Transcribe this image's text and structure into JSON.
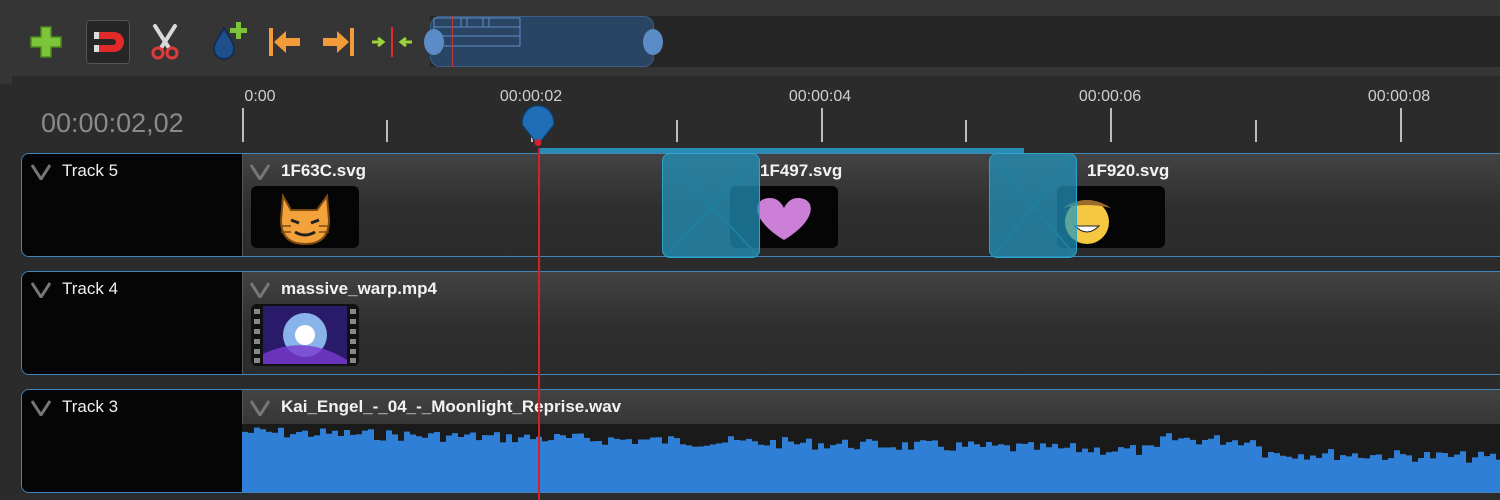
{
  "toolbar": {
    "buttons": [
      {
        "name": "add-track",
        "icon": "plus-icon"
      },
      {
        "name": "snapping",
        "icon": "magnet-icon",
        "active": true
      },
      {
        "name": "razor",
        "icon": "scissors-icon"
      },
      {
        "name": "add-marker",
        "icon": "drop-plus-icon"
      },
      {
        "name": "previous-marker",
        "icon": "arrow-left-bar-icon"
      },
      {
        "name": "next-marker",
        "icon": "arrow-right-bar-icon"
      },
      {
        "name": "center-playhead",
        "icon": "center-arrows-icon"
      }
    ]
  },
  "timeline": {
    "current_time": "00:00:02,02",
    "ruler_labels": [
      "0:00",
      "00:00:02",
      "00:00:04",
      "00:00:06",
      "00:00:08"
    ]
  },
  "tracks": [
    {
      "name": "Track 5",
      "clips": [
        "1F63C.svg",
        "1F497.svg",
        "1F920.svg"
      ]
    },
    {
      "name": "Track 4",
      "clips": [
        "massive_warp.mp4"
      ]
    },
    {
      "name": "Track 3",
      "clips": [
        "Kai_Engel_-_04_-_Moonlight_Reprise.wav"
      ]
    }
  ],
  "colors": {
    "accent": "#3f87bb",
    "playhead": "#d5202a",
    "waveform": "#2f7fd6",
    "transition": "#2396be"
  }
}
